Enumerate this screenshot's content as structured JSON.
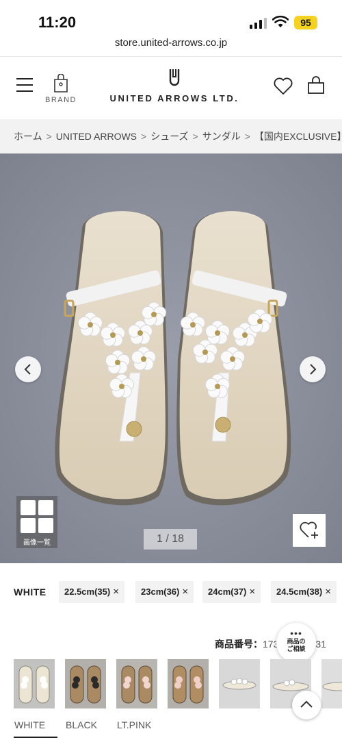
{
  "status_bar": {
    "time": "11:20",
    "battery": "95"
  },
  "browser": {
    "url": "store.united-arrows.co.jp"
  },
  "header": {
    "brand_label": "BRAND",
    "logo_text": "UNITED ARROWS LTD."
  },
  "breadcrumb": [
    "ホーム",
    "UNITED ARROWS",
    "シューズ",
    "サンダル",
    "【国内EXCLUSIVE】<B"
  ],
  "gallery": {
    "label": "画像一覧",
    "counter": "1 / 18"
  },
  "selection": {
    "color": "WHITE",
    "sizes": [
      "22.5cm(35)",
      "23cm(36)",
      "24cm(37)",
      "24.5cm(38)"
    ],
    "remove_glyph": "×"
  },
  "product": {
    "number_label": "商品番号：",
    "number_value": "173",
    "number_tail": "31"
  },
  "consult": {
    "line1": "商品の",
    "line2": "ご相談"
  },
  "swatches": [
    "WHITE",
    "BLACK",
    "LT.PINK"
  ]
}
